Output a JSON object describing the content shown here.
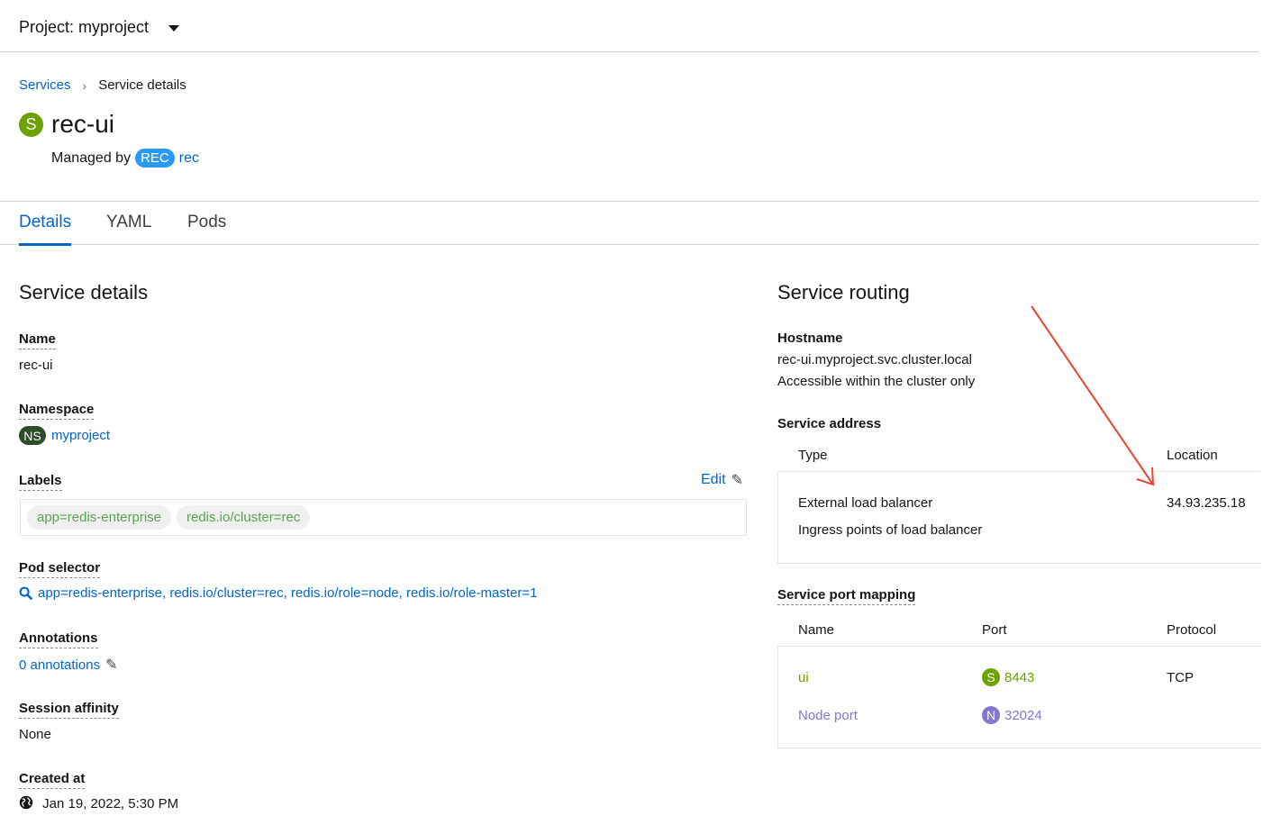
{
  "header": {
    "project_label": "Project: myproject"
  },
  "breadcrumb": {
    "parent": "Services",
    "current": "Service details"
  },
  "resource": {
    "badge": "S",
    "name": "rec-ui",
    "managed_by_prefix": "Managed by",
    "owner_badge": "REC",
    "owner_name": "rec"
  },
  "tabs": [
    {
      "label": "Details",
      "active": true
    },
    {
      "label": "YAML",
      "active": false
    },
    {
      "label": "Pods",
      "active": false
    }
  ],
  "details": {
    "heading": "Service details",
    "name_label": "Name",
    "name_value": "rec-ui",
    "namespace_label": "Namespace",
    "namespace_badge": "NS",
    "namespace_value": "myproject",
    "labels_label": "Labels",
    "labels_edit": "Edit",
    "labels": [
      "app=redis-enterprise",
      "redis.io/cluster=rec"
    ],
    "pod_selector_label": "Pod selector",
    "pod_selector_value": "app=redis-enterprise, redis.io/cluster=rec, redis.io/role=node, redis.io/role-master=1",
    "annotations_label": "Annotations",
    "annotations_value": "0 annotations",
    "session_affinity_label": "Session affinity",
    "session_affinity_value": "None",
    "created_label": "Created at",
    "created_value": "Jan 19, 2022, 5:30 PM"
  },
  "routing": {
    "heading": "Service routing",
    "hostname_label": "Hostname",
    "hostname_value": "rec-ui.myproject.svc.cluster.local",
    "hostname_note": "Accessible within the cluster only",
    "address_label": "Service address",
    "address_columns": [
      "Type",
      "Location"
    ],
    "address_type": "External load balancer",
    "address_type_note": "Ingress points of load balancer",
    "address_location": "34.93.235.18",
    "port_label": "Service port mapping",
    "port_columns": [
      "Name",
      "Port",
      "Protocol"
    ],
    "ports": [
      {
        "name": "ui",
        "badge": "S",
        "port": "8443",
        "protocol": "TCP"
      },
      {
        "name": "Node port",
        "badge": "N",
        "port": "32024",
        "protocol": ""
      }
    ]
  },
  "colors": {
    "link": "#0066cc",
    "service_badge": "#6ca100",
    "node_badge": "#8476d1",
    "namespace_badge": "#2d4d2a",
    "owner_badge": "#2b9af3",
    "annotation_arrow": "#e8442f"
  },
  "icons": {
    "dropdown": "caret-down-icon",
    "breadcrumb_separator": "chevron-right-icon",
    "edit": "pencil-icon",
    "search": "search-icon",
    "created": "globe-icon"
  }
}
